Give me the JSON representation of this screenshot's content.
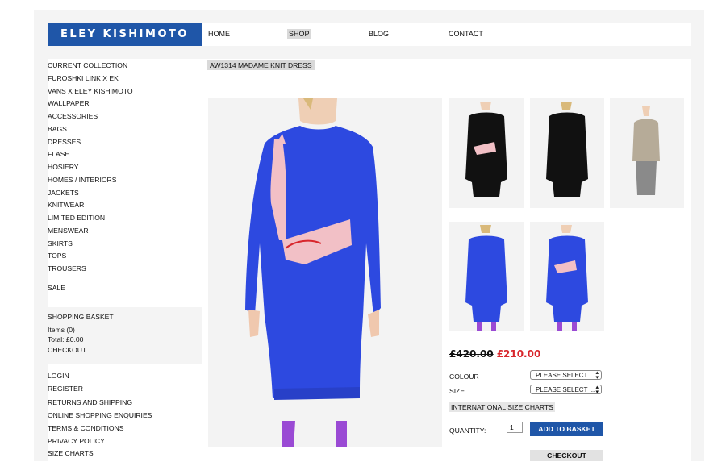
{
  "brand": {
    "logo_text": "ELEY KISHIMOTO"
  },
  "topnav": {
    "home": "HOME",
    "shop": "SHOP",
    "blog": "BLOG",
    "contact": "CONTACT"
  },
  "sidebar": {
    "categories": [
      "CURRENT COLLECTION",
      "FUROSHKI LINK X EK",
      "VANS X ELEY KISHIMOTO",
      "WALLPAPER",
      "ACCESSORIES",
      "BAGS",
      "DRESSES",
      "FLASH",
      "HOSIERY",
      "HOMES / INTERIORS",
      "JACKETS",
      "KNITWEAR",
      "LIMITED EDITION",
      "MENSWEAR",
      "SKIRTS",
      "TOPS",
      "TROUSERS"
    ],
    "sale": "SALE"
  },
  "basket": {
    "title": "SHOPPING BASKET",
    "items": "Items (0)",
    "total": "Total: £0.00",
    "checkout": "CHECKOUT"
  },
  "account": {
    "links": [
      "LOGIN",
      "REGISTER",
      "RETURNS AND SHIPPING",
      "ONLINE SHOPPING ENQUIRIES",
      "TERMS & CONDITIONS",
      "PRIVACY POLICY",
      "SIZE CHARTS"
    ]
  },
  "product": {
    "title": "AW1314 MADAME KNIT DRESS",
    "old_price": "£420.00",
    "new_price": "£210.00",
    "colour_label": "COLOUR",
    "colour_value": "PLEASE SELECT ...",
    "size_label": "SIZE",
    "size_value": "PLEASE SELECT ...",
    "size_charts_link": "INTERNATIONAL SIZE CHARTS",
    "quantity_label": "QUANTITY:",
    "quantity_value": "1",
    "add_to_basket": "ADD TO BASKET",
    "checkout": "CHECKOUT"
  },
  "colors": {
    "brand_blue": "#1f56a8",
    "sale_red": "#d8262c",
    "dress_blue": "#2d49e0"
  }
}
